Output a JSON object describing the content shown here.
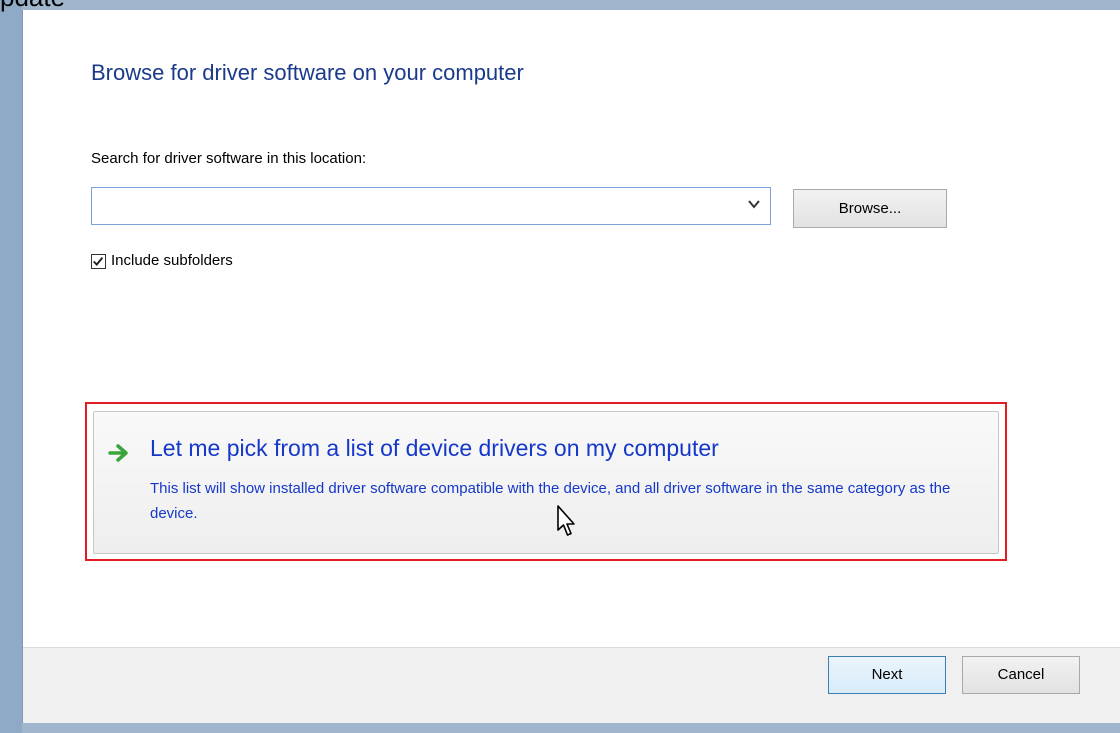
{
  "window": {
    "title_fragment": "pdate"
  },
  "dialog": {
    "heading": "Browse for driver software on your computer",
    "search_label": "Search for driver software in this location:",
    "path_input": {
      "value": "",
      "placeholder": ""
    },
    "browse_label": "Browse...",
    "include_subfolders": {
      "label": "Include subfolders",
      "checked": true
    },
    "pick_option": {
      "title": "Let me pick from a list of device drivers on my computer",
      "description": "This list will show installed driver software compatible with the device, and all driver software in the same category as the device."
    },
    "footer": {
      "next_label": "Next",
      "cancel_label": "Cancel"
    }
  },
  "icons": {
    "combo_arrow": "chevron-down-icon",
    "checkbox_mark": "checkmark-icon",
    "option_arrow": "arrow-right-icon",
    "pointer": "mouse-cursor-icon"
  },
  "colors": {
    "heading": "#1a3a8c",
    "link": "#1538c9",
    "highlight_border": "#e31b23",
    "option_arrow": "#3aa53a",
    "frame": "#9fb6cd"
  }
}
